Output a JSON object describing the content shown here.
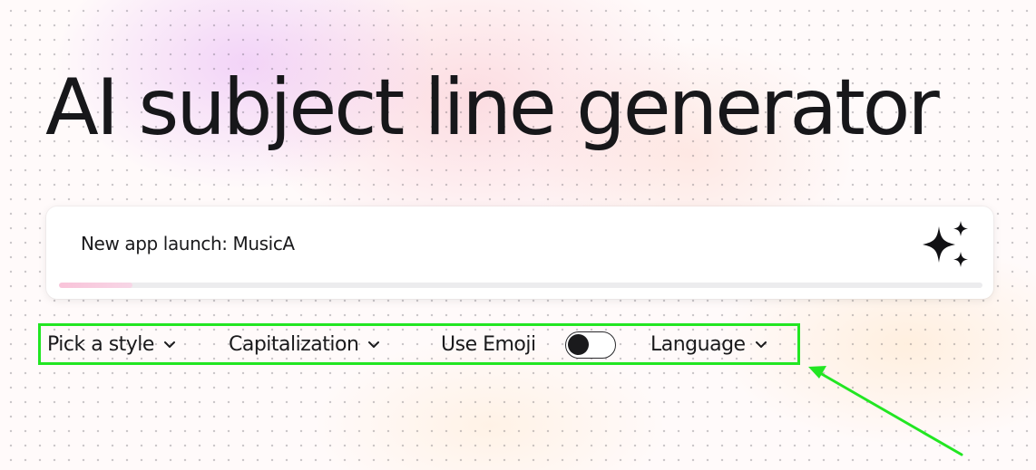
{
  "page": {
    "title": "AI subject line generator"
  },
  "prompt": {
    "value": "New app launch: MusicA",
    "progress": 0.08,
    "generate_icon": "sparkle-icon"
  },
  "options": {
    "style_label": "Pick a style",
    "capitalization_label": "Capitalization",
    "emoji_label": "Use Emoji",
    "emoji_enabled": false,
    "language_label": "Language",
    "dropdown_icon": "chevron-down-icon"
  },
  "annotation": {
    "highlight_color": "#22e622",
    "arrow_color": "#22e622"
  }
}
